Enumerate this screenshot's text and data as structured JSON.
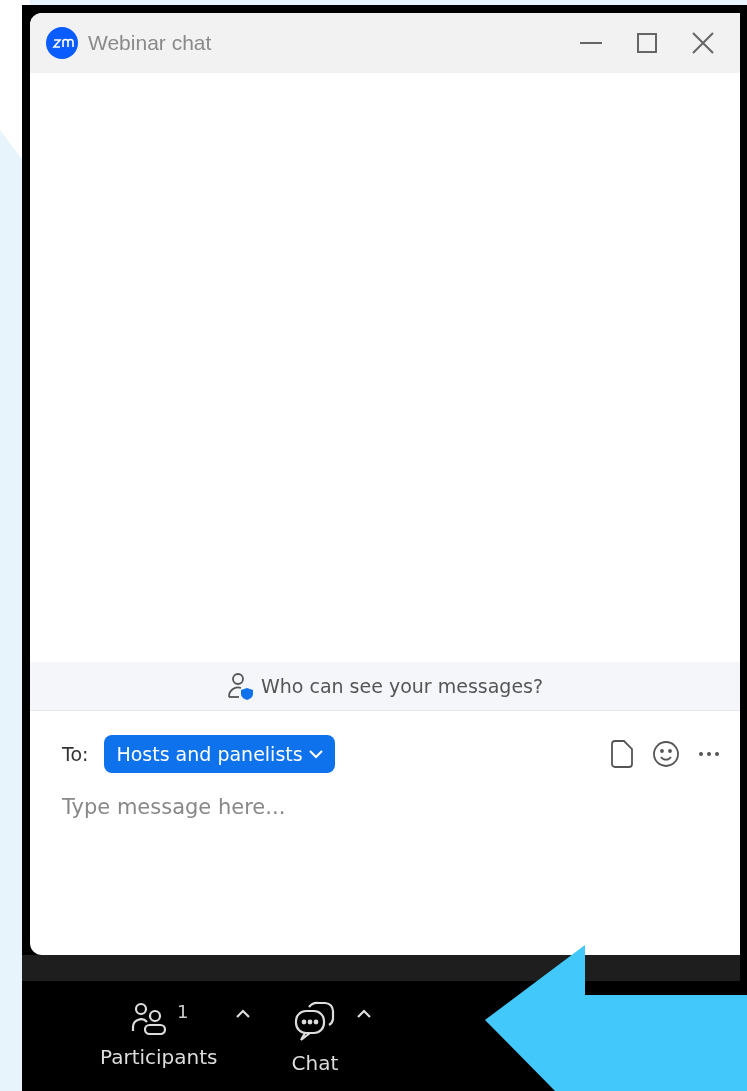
{
  "window": {
    "title": "Webinar chat"
  },
  "privacy_banner": {
    "text": "Who can see your messages?"
  },
  "composer": {
    "to_label": "To:",
    "recipient": "Hosts and panelists",
    "placeholder": "Type message here..."
  },
  "toolbar": [
    {
      "kind": "participants",
      "label": "Participants",
      "count": "1"
    },
    {
      "kind": "chat",
      "label": "Chat"
    }
  ]
}
